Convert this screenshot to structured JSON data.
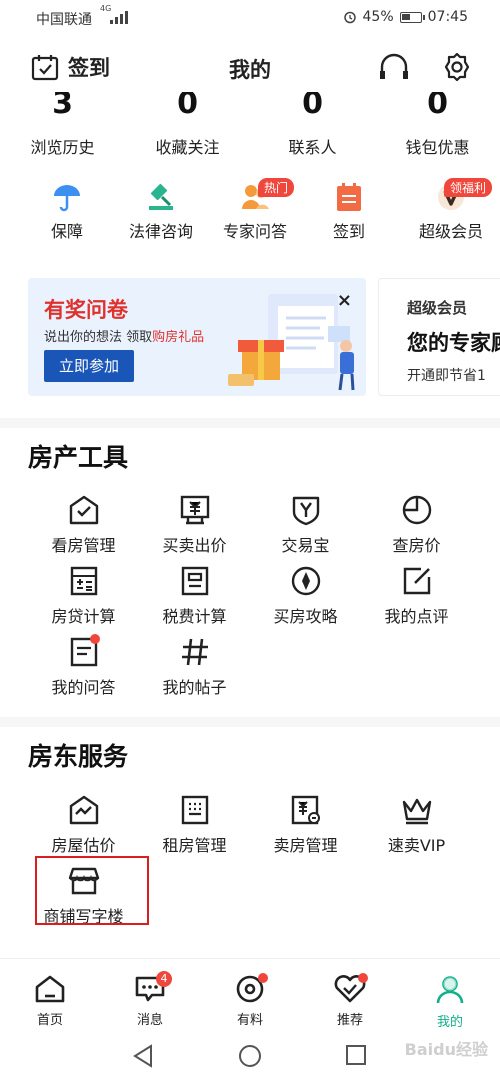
{
  "status_bar": {
    "carrier": "中国联通",
    "network": "4G",
    "battery": "45%",
    "time": "07:45"
  },
  "header": {
    "checkin_label": "签到",
    "title": "我的"
  },
  "stats": [
    {
      "value": "3",
      "label": "浏览历史"
    },
    {
      "value": "0",
      "label": "收藏关注"
    },
    {
      "value": "0",
      "label": "联系人"
    },
    {
      "value": "0",
      "label": "钱包优惠"
    }
  ],
  "shortcuts": [
    {
      "label": "保障",
      "icon": "umbrella-icon",
      "badge": ""
    },
    {
      "label": "法律咨询",
      "icon": "gavel-icon",
      "badge": ""
    },
    {
      "label": "专家问答",
      "icon": "experts-icon",
      "badge": "热门"
    },
    {
      "label": "签到",
      "icon": "calendar-icon",
      "badge": ""
    },
    {
      "label": "超级会员",
      "icon": "vip-icon",
      "badge": "领福利"
    }
  ],
  "banner_survey": {
    "title": "有奖问卷",
    "subtitle_prefix": "说出你的想法 领取",
    "subtitle_highlight": "购房礼品",
    "button": "立即参加",
    "close": "×"
  },
  "banner_vip": {
    "label": "超级会员",
    "title": "您的专家顾",
    "subtitle": "开通即节省1"
  },
  "property_tools": {
    "title": "房产工具",
    "items": [
      {
        "label": "看房管理",
        "icon": "house-check-icon",
        "dot": false
      },
      {
        "label": "买卖出价",
        "icon": "yuan-board-icon",
        "dot": false
      },
      {
        "label": "交易宝",
        "icon": "shield-y-icon",
        "dot": false
      },
      {
        "label": "查房价",
        "icon": "pie-clock-icon",
        "dot": false
      },
      {
        "label": "房贷计算",
        "icon": "calculator-icon",
        "dot": false
      },
      {
        "label": "税费计算",
        "icon": "tax-doc-icon",
        "dot": false
      },
      {
        "label": "买房攻略",
        "icon": "compass-icon",
        "dot": false
      },
      {
        "label": "我的点评",
        "icon": "edit-icon",
        "dot": false
      },
      {
        "label": "我的问答",
        "icon": "qa-doc-icon",
        "dot": true
      },
      {
        "label": "我的帖子",
        "icon": "hashtag-icon",
        "dot": false
      }
    ]
  },
  "landlord_services": {
    "title": "房东服务",
    "items": [
      {
        "label": "房屋估价",
        "icon": "house-chart-icon"
      },
      {
        "label": "租房管理",
        "icon": "building-icon"
      },
      {
        "label": "卖房管理",
        "icon": "sell-doc-icon"
      },
      {
        "label": "速卖VIP",
        "icon": "crown-icon"
      },
      {
        "label": "商铺写字楼",
        "icon": "shop-icon"
      }
    ]
  },
  "bottom_nav": [
    {
      "label": "首页",
      "icon": "home-icon",
      "badge": "",
      "dot": false,
      "active": false
    },
    {
      "label": "消息",
      "icon": "message-icon",
      "badge": "4",
      "dot": false,
      "active": false
    },
    {
      "label": "有料",
      "icon": "disc-icon",
      "badge": "",
      "dot": true,
      "active": false
    },
    {
      "label": "推荐",
      "icon": "heart-check-icon",
      "badge": "",
      "dot": true,
      "active": false
    },
    {
      "label": "我的",
      "icon": "user-icon",
      "badge": "",
      "dot": false,
      "active": true
    }
  ],
  "colors": {
    "accent_green": "#12b08a",
    "badge_red": "#f0473c",
    "survey_blue": "#1a56b8"
  },
  "watermark": "Baidu经验"
}
